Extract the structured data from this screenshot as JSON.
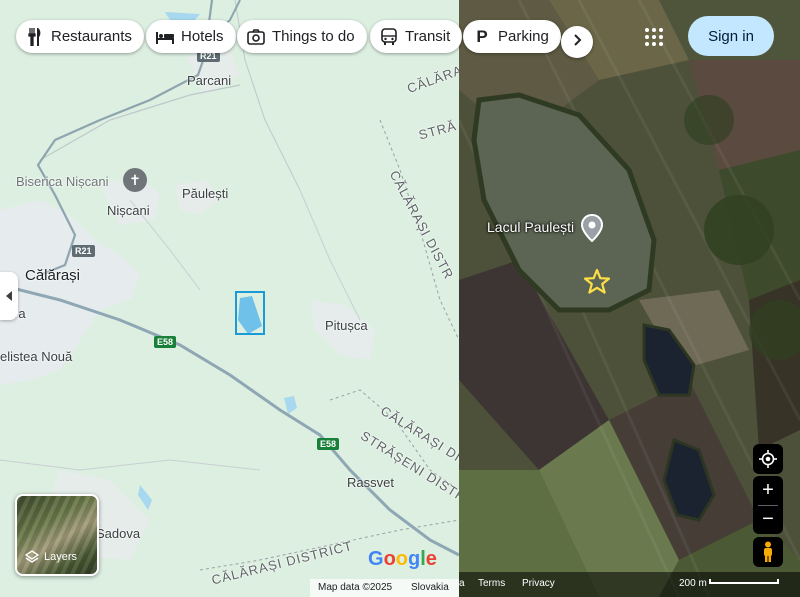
{
  "chips": [
    {
      "label": "Restaurants",
      "icon": "fork-knife-icon"
    },
    {
      "label": "Hotels",
      "icon": "bed-icon"
    },
    {
      "label": "Things to do",
      "icon": "camera-icon"
    },
    {
      "label": "Transit",
      "icon": "bus-icon"
    },
    {
      "label": "Parking",
      "icon": "parking-icon"
    }
  ],
  "header": {
    "sign_in": "Sign in",
    "more_chips_icon": "chevron-right-icon",
    "apps_icon": "apps-grid-icon"
  },
  "places": {
    "parcani": "Parcani",
    "biserica": "Biserica Nișcani",
    "niscani": "Nișcani",
    "paulesti": "Păulești",
    "calarasi": "Călărași",
    "ra": "ra",
    "selistea": "elistea Nouă",
    "pitusca": "Pitușca",
    "rassvet": "Rassvet",
    "sadova": "Sadova",
    "lake": "Lacul Paulești"
  },
  "districts": {
    "d1": "CĂLĂRA",
    "d2": "STRĂ",
    "d3": "CĂLĂRAȘI DISTR",
    "d4": "CĂLĂRAȘI DISTRICT",
    "d5": "STRĂȘENI DISTRICT",
    "d6": "CĂLĂRAȘI DISTRICT"
  },
  "roads": {
    "r21_top": "R21",
    "r21": "R21",
    "e58_a": "E58",
    "e58_b": "E58"
  },
  "layers": {
    "label": "Layers"
  },
  "footer": {
    "map_data": "Map data ©2025",
    "country": "Slovakia",
    "terms": "Terms",
    "privacy": "Privacy",
    "scale": "200 m",
    "partial": "a"
  },
  "brand": {
    "google": "Google"
  },
  "colors": {
    "accent_blue": "#1a73e8",
    "signin_bg": "#c2e7ff",
    "road_green": "#188038",
    "highlight_star": "#fde047"
  }
}
